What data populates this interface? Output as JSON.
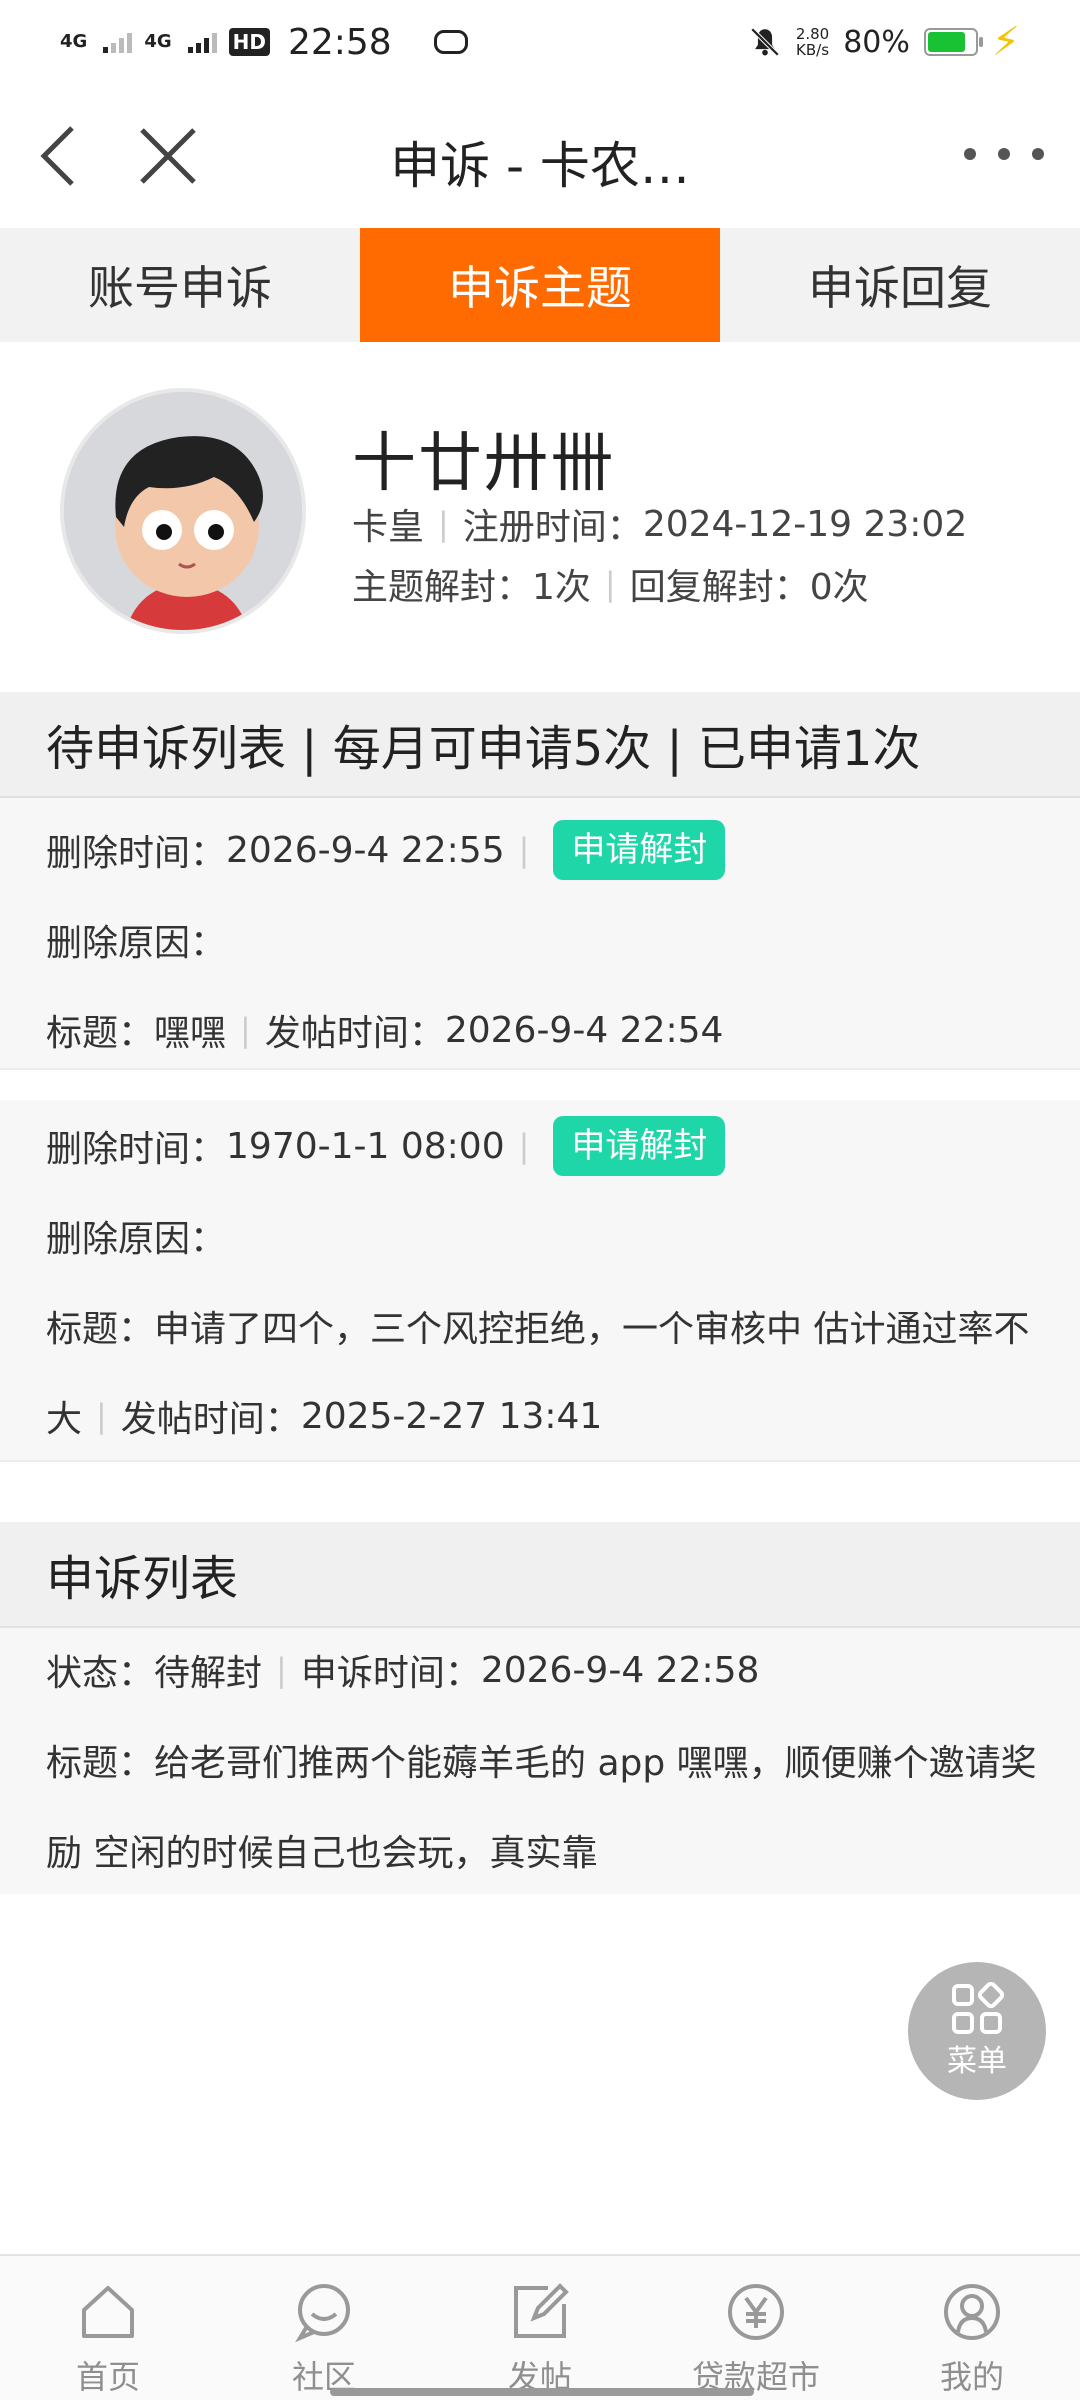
{
  "status_bar": {
    "signal1": "4G",
    "signal2": "4G",
    "hd": "HD",
    "time": "22:58",
    "net_speed_value": "2.80",
    "net_speed_unit": "KB/s",
    "battery_percent": "80%",
    "battery_level": 0.8
  },
  "nav": {
    "title": "申诉 - 卡农…"
  },
  "tabs": [
    {
      "label": "账号申诉",
      "active": false
    },
    {
      "label": "申诉主题",
      "active": true
    },
    {
      "label": "申诉回复",
      "active": false
    }
  ],
  "profile": {
    "name": "十廿卅卌",
    "level": "卡皇",
    "register_label": "注册时间：",
    "register_time": "2024-12-19 23:02",
    "topic_unseal_label": "主题解封：",
    "topic_unseal_count": "1次",
    "reply_unseal_label": "回复解封：",
    "reply_unseal_count": "0次"
  },
  "pending_section": {
    "title": "待申诉列表 | 每月可申请5次 | 已申请1次",
    "items": [
      {
        "delete_time_label": "删除时间：",
        "delete_time": "2026-9-4 22:55",
        "button": "申请解封",
        "reason_label": "删除原因：",
        "reason": "",
        "title_label": "标题：",
        "title": "嘿嘿",
        "post_time_label": "发帖时间：",
        "post_time": "2026-9-4 22:54"
      },
      {
        "delete_time_label": "删除时间：",
        "delete_time": "1970-1-1 08:00",
        "button": "申请解封",
        "reason_label": "删除原因：",
        "reason": "",
        "title_label": "标题：",
        "title_line1": "申请了四个，三个风控拒绝，一个审核中 估计通过率不",
        "title_line2": "大",
        "post_time_label": "发帖时间：",
        "post_time": "2025-2-27 13:41"
      }
    ]
  },
  "appeal_section": {
    "title": "申诉列表",
    "items": [
      {
        "status_label": "状态：",
        "status": "待解封",
        "appeal_time_label": "申诉时间：",
        "appeal_time": "2026-9-4 22:58",
        "title_label": "标题：",
        "title_line1": "给老哥们推两个能薅羊毛的 app 嘿嘿，顺便赚个邀请奖",
        "title_line2": "励 空闲的时候自己也会玩，真实靠"
      }
    ]
  },
  "fab": {
    "label": "菜单"
  },
  "bottom_nav": [
    {
      "label": "首页",
      "icon": "home-icon"
    },
    {
      "label": "社区",
      "icon": "chat-icon"
    },
    {
      "label": "发帖",
      "icon": "edit-icon"
    },
    {
      "label": "贷款超市",
      "icon": "yen-icon"
    },
    {
      "label": "我的",
      "icon": "user-icon"
    }
  ]
}
